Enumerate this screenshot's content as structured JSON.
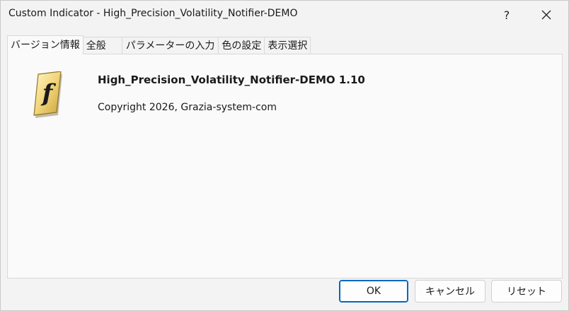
{
  "window": {
    "title": "Custom Indicator - High_Precision_Volatility_Notifier-DEMO",
    "help_label": "?"
  },
  "tabs": [
    {
      "label": "バージョン情報",
      "active": true
    },
    {
      "label": "全般",
      "active": false
    },
    {
      "label": "パラメーターの入力",
      "active": false
    },
    {
      "label": "色の設定",
      "active": false
    },
    {
      "label": "表示選択",
      "active": false
    }
  ],
  "about": {
    "name": "High_Precision_Volatility_Notifier-DEMO 1.10",
    "copyright": "Copyright 2026, Grazia-system-com",
    "icon": "script-f-icon"
  },
  "buttons": {
    "ok": "OK",
    "cancel": "キャンセル",
    "reset": "リセット"
  },
  "colors": {
    "accent": "#0067c0",
    "logo_gold": "#e8c65a"
  }
}
